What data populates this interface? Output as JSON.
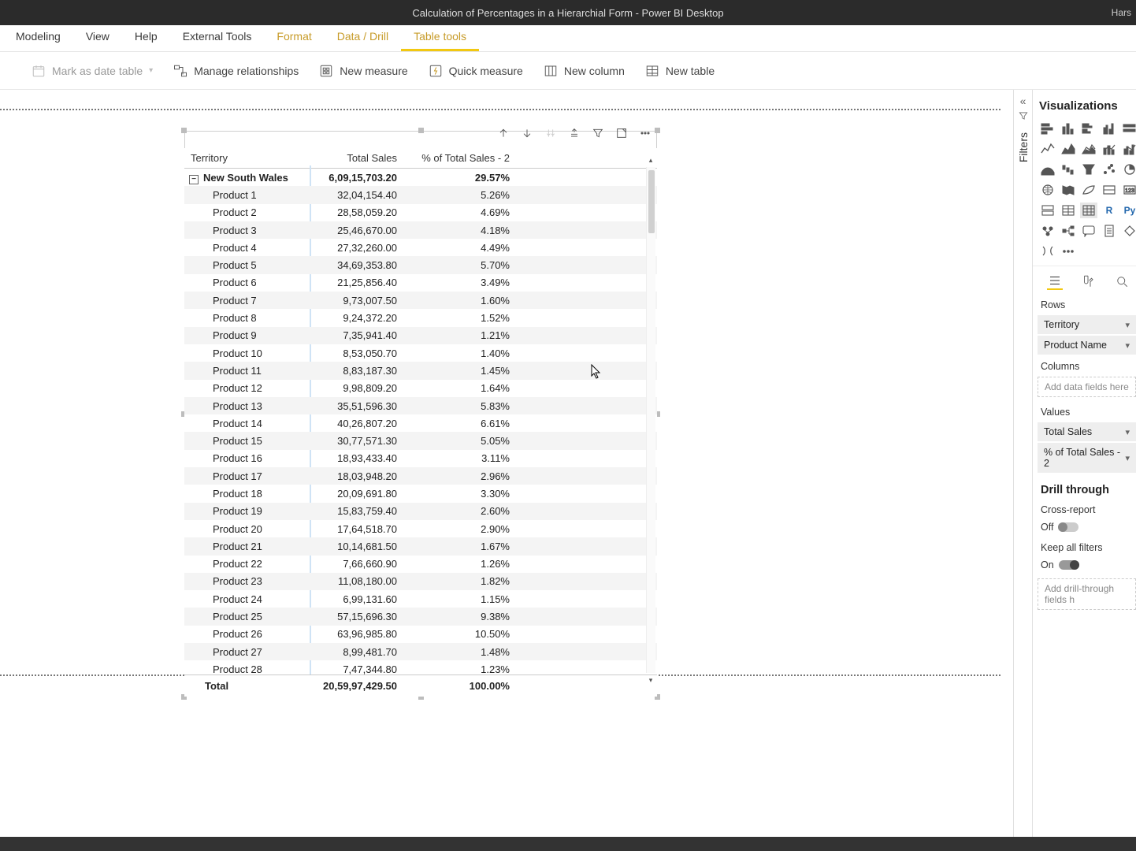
{
  "titlebar": {
    "title": "Calculation of Percentages in a Hierarchial Form - Power BI Desktop",
    "right": "Hars"
  },
  "tabs": {
    "modeling": "Modeling",
    "view": "View",
    "help": "Help",
    "external": "External Tools",
    "format": "Format",
    "datadrill": "Data / Drill",
    "tabletools": "Table tools"
  },
  "ribbon": {
    "mark_date": "Mark as date table",
    "manage_rel": "Manage relationships",
    "new_measure": "New measure",
    "quick_measure": "Quick measure",
    "new_column": "New column",
    "new_table": "New table"
  },
  "matrix": {
    "headers": {
      "c1": "Territory",
      "c2": "Total Sales",
      "c3": "% of Total Sales - 2"
    },
    "group": {
      "name": "New South Wales",
      "total": "6,09,15,703.20",
      "pct": "29.57%"
    },
    "rows": [
      {
        "name": "Product 1",
        "val": "32,04,154.40",
        "pct": "5.26%"
      },
      {
        "name": "Product 2",
        "val": "28,58,059.20",
        "pct": "4.69%"
      },
      {
        "name": "Product 3",
        "val": "25,46,670.00",
        "pct": "4.18%"
      },
      {
        "name": "Product 4",
        "val": "27,32,260.00",
        "pct": "4.49%"
      },
      {
        "name": "Product 5",
        "val": "34,69,353.80",
        "pct": "5.70%"
      },
      {
        "name": "Product 6",
        "val": "21,25,856.40",
        "pct": "3.49%"
      },
      {
        "name": "Product 7",
        "val": "9,73,007.50",
        "pct": "1.60%"
      },
      {
        "name": "Product 8",
        "val": "9,24,372.20",
        "pct": "1.52%"
      },
      {
        "name": "Product 9",
        "val": "7,35,941.40",
        "pct": "1.21%"
      },
      {
        "name": "Product 10",
        "val": "8,53,050.70",
        "pct": "1.40%"
      },
      {
        "name": "Product 11",
        "val": "8,83,187.30",
        "pct": "1.45%"
      },
      {
        "name": "Product 12",
        "val": "9,98,809.20",
        "pct": "1.64%"
      },
      {
        "name": "Product 13",
        "val": "35,51,596.30",
        "pct": "5.83%"
      },
      {
        "name": "Product 14",
        "val": "40,26,807.20",
        "pct": "6.61%"
      },
      {
        "name": "Product 15",
        "val": "30,77,571.30",
        "pct": "5.05%"
      },
      {
        "name": "Product 16",
        "val": "18,93,433.40",
        "pct": "3.11%"
      },
      {
        "name": "Product 17",
        "val": "18,03,948.20",
        "pct": "2.96%"
      },
      {
        "name": "Product 18",
        "val": "20,09,691.80",
        "pct": "3.30%"
      },
      {
        "name": "Product 19",
        "val": "15,83,759.40",
        "pct": "2.60%"
      },
      {
        "name": "Product 20",
        "val": "17,64,518.70",
        "pct": "2.90%"
      },
      {
        "name": "Product 21",
        "val": "10,14,681.50",
        "pct": "1.67%"
      },
      {
        "name": "Product 22",
        "val": "7,66,660.90",
        "pct": "1.26%"
      },
      {
        "name": "Product 23",
        "val": "11,08,180.00",
        "pct": "1.82%"
      },
      {
        "name": "Product 24",
        "val": "6,99,131.60",
        "pct": "1.15%"
      },
      {
        "name": "Product 25",
        "val": "57,15,696.30",
        "pct": "9.38%"
      },
      {
        "name": "Product 26",
        "val": "63,96,985.80",
        "pct": "10.50%"
      },
      {
        "name": "Product 27",
        "val": "8,99,481.70",
        "pct": "1.48%"
      },
      {
        "name": "Product 28",
        "val": "7,47,344.80",
        "pct": "1.23%"
      }
    ],
    "footer": {
      "label": "Total",
      "val": "20,59,97,429.50",
      "pct": "100.00%"
    }
  },
  "filters": {
    "label": "Filters"
  },
  "viz": {
    "title": "Visualizations",
    "rows_label": "Rows",
    "rows_items": [
      "Territory",
      "Product Name"
    ],
    "columns_label": "Columns",
    "columns_ph": "Add data fields here",
    "values_label": "Values",
    "values_items": [
      "Total Sales",
      "% of Total Sales - 2"
    ],
    "drill_title": "Drill through",
    "cross_report": "Cross-report",
    "off": "Off",
    "keep_filters": "Keep all filters",
    "on": "On",
    "drill_ph": "Add drill-through fields h"
  },
  "viz_types": {
    "r": "R",
    "py": "Py"
  }
}
